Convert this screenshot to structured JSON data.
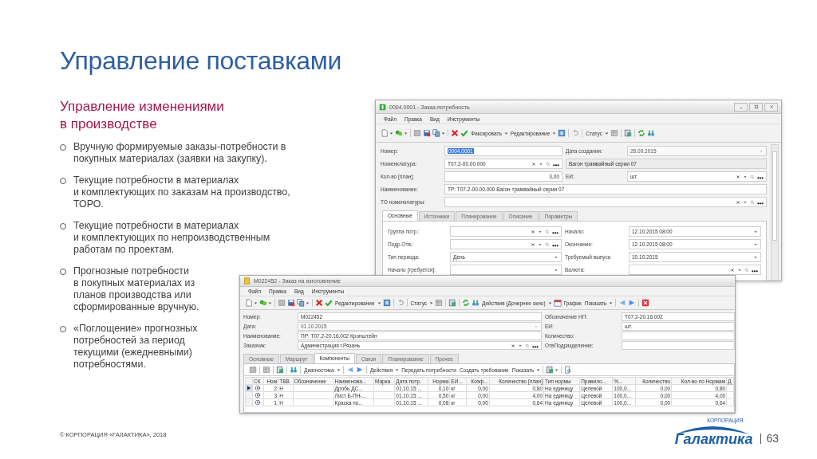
{
  "slide": {
    "title": "Управление поставками",
    "subtitle": "Управление изменениями\nв производстве",
    "bullets": [
      "Вручную формируемые заказы-потребности в\nпокупных материалах (заявки на закупку).",
      "Текущие потребности в материалах\nи комплектующих по заказам на производство,\nТОРО.",
      "Текущие потребности в материалах\nи комплектующих по непроизводственным\nработам по проектам.",
      "Прогнозные потребности\nв покупных материалах из\nпланов производства или\nсформированные вручную.",
      "«Поглощение» прогнозных\nпотребностей за период\nтекущими (ежедневными)\nпотребностями."
    ],
    "footer": "© КОРПОРАЦИЯ «ГАЛАКТИКА», 2018",
    "logo": {
      "tagline": "КОРПОРАЦИЯ",
      "name": "Галактика"
    },
    "page_number": "63"
  },
  "windows": [
    {
      "title": "0004.0001 - Заказ-потребность",
      "menu": [
        "Файл",
        "Правка",
        "Вид",
        "Инструменты"
      ],
      "toolbar": [
        {
          "kind": "new",
          "menu": true
        },
        {
          "kind": "add",
          "menu": true
        },
        {
          "kind": "separator"
        },
        {
          "kind": "store"
        },
        {
          "kind": "save"
        },
        {
          "kind": "copy",
          "menu": true
        },
        {
          "kind": "separator"
        },
        {
          "kind": "delete"
        },
        {
          "kind": "confirm"
        },
        {
          "kind": "text",
          "label": "Фиксировать",
          "menu": true
        },
        {
          "kind": "text",
          "label": "Редактирование",
          "menu": true
        },
        {
          "kind": "help"
        },
        {
          "kind": "separator"
        },
        {
          "kind": "undo"
        },
        {
          "kind": "separator"
        },
        {
          "kind": "text",
          "label": "Статус",
          "menu": true
        },
        {
          "kind": "grid"
        },
        {
          "kind": "separator"
        },
        {
          "kind": "report"
        },
        {
          "kind": "separator"
        },
        {
          "kind": "refresh"
        },
        {
          "kind": "find"
        }
      ],
      "form": [
        [
          {
            "label": "Номер:",
            "value": "0004.0001",
            "kind": "focused"
          },
          {
            "label": "Дата создания:",
            "value": "28.09.2015",
            "kind": "locked"
          }
        ],
        [
          {
            "label": "Номенклатура:",
            "value": "Т07.2-00.00.000",
            "kind": "lookup"
          },
          {
            "value": "Вагон трамвайный серии 07",
            "kind": "readonly"
          }
        ],
        [
          {
            "label": "Кол-во [план]:",
            "value": "3,00",
            "kind": "number"
          },
          {
            "label": "ЕИ:",
            "value": "шт.",
            "kind": "lookup"
          }
        ],
        [
          {
            "label": "Наименование:",
            "value": "ТР: Т07.2-00.00.000 Вагон трамвайный серии 07",
            "kind": "text",
            "wide": true
          }
        ],
        [
          {
            "label": "ТО номенклатуры:",
            "kind": "lookup",
            "wide": true
          }
        ]
      ],
      "tabs": [
        {
          "label": "Основные",
          "selected": true
        },
        {
          "label": "Источники",
          "selected": false
        },
        {
          "label": "Планирование",
          "selected": false
        },
        {
          "label": "Описание",
          "selected": false
        },
        {
          "label": "Параметры",
          "selected": false
        }
      ],
      "panel": [
        [
          {
            "label": "Группа потр.:",
            "kind": "lookup"
          },
          {
            "label": "Начало:",
            "value": "12.10.2015 08:00",
            "kind": "combo"
          }
        ],
        [
          {
            "label": "Подр.Отв.:",
            "kind": "lookup"
          },
          {
            "label": "Окончание:",
            "value": "12.10.2015 08:00",
            "kind": "combo"
          }
        ],
        [
          {
            "label": "Тип периода:",
            "value": "День",
            "kind": "combo"
          },
          {
            "label": "Требуемый выпуск:",
            "value": "10.10.2015",
            "kind": "combo"
          }
        ],
        [
          {
            "label": "Начало [требуется]:",
            "kind": "combo"
          },
          {
            "label": "Валюта:",
            "kind": "lookup"
          }
        ]
      ]
    },
    {
      "title": "М022452 - Заказ на изготовление",
      "menu": [
        "Файл",
        "Правка",
        "Вид",
        "Инструменты"
      ],
      "toolbar": [
        {
          "kind": "new",
          "menu": true
        },
        {
          "kind": "add",
          "menu": true
        },
        {
          "kind": "separator"
        },
        {
          "kind": "store"
        },
        {
          "kind": "save"
        },
        {
          "kind": "copy",
          "menu": true
        },
        {
          "kind": "separator"
        },
        {
          "kind": "delete"
        },
        {
          "kind": "confirm"
        },
        {
          "kind": "text",
          "label": "Редактирование",
          "menu": true
        },
        {
          "kind": "help"
        },
        {
          "kind": "separator"
        },
        {
          "kind": "undo"
        },
        {
          "kind": "separator"
        },
        {
          "kind": "text",
          "label": "Статус",
          "menu": true
        },
        {
          "kind": "grid"
        },
        {
          "kind": "separator"
        },
        {
          "kind": "report"
        },
        {
          "kind": "separator"
        },
        {
          "kind": "refresh"
        },
        {
          "kind": "find"
        },
        {
          "kind": "text",
          "label": "Действия (Дочернее окно)",
          "menu": true
        },
        {
          "kind": "calendar"
        },
        {
          "kind": "text",
          "label": "График"
        },
        {
          "kind": "text",
          "label": "Показать",
          "menu": true
        },
        {
          "kind": "separator"
        },
        {
          "kind": "back"
        },
        {
          "kind": "forward"
        },
        {
          "kind": "separator"
        },
        {
          "kind": "close"
        }
      ],
      "form": [
        [
          {
            "label": "Номер:",
            "value": "М022452",
            "kind": "text"
          },
          {
            "label": "Обозначение НП:",
            "value": "Т07.2-20.16.002",
            "kind": "text"
          }
        ],
        [
          {
            "label": "Дата:",
            "value": "01.10.2015",
            "kind": "locked"
          },
          {
            "label": "ЕИ:",
            "value": "шт.",
            "kind": "text"
          }
        ],
        [
          {
            "label": "Наименование:",
            "value": "ПР: Т07.2-20.16.002 Кронштейн",
            "kind": "text"
          },
          {
            "label": "Количество:",
            "kind": "text"
          }
        ],
        [
          {
            "label": "Заказчик:",
            "value": "Администрация г.Рязань",
            "kind": "lookup"
          },
          {
            "label": "ОтвПодразделение:",
            "kind": "text"
          }
        ]
      ],
      "tabs": [
        {
          "label": "Основные",
          "selected": false
        },
        {
          "label": "Маршрут",
          "selected": false
        },
        {
          "label": "Компоненты",
          "selected": true
        },
        {
          "label": "Связи",
          "selected": false
        },
        {
          "label": "Планирование",
          "selected": false
        },
        {
          "label": "Прочее",
          "selected": false
        }
      ],
      "subtoolbar": [
        {
          "kind": "store"
        },
        {
          "kind": "separator"
        },
        {
          "kind": "grid"
        },
        {
          "kind": "separator"
        },
        {
          "kind": "report"
        },
        {
          "kind": "separator"
        },
        {
          "kind": "find"
        },
        {
          "kind": "separator"
        },
        {
          "kind": "text",
          "label": "Диагностика",
          "menu": true
        },
        {
          "kind": "separator"
        },
        {
          "kind": "back"
        },
        {
          "kind": "forward"
        },
        {
          "kind": "separator"
        },
        {
          "kind": "text",
          "label": "Действия",
          "menu": true
        },
        {
          "kind": "text",
          "label": "Передать потребности"
        },
        {
          "kind": "text",
          "label": "Создать требование"
        },
        {
          "kind": "text",
          "label": "Показать",
          "menu": true
        },
        {
          "kind": "separator"
        },
        {
          "kind": "report",
          "menu": true
        },
        {
          "kind": "separator"
        },
        {
          "kind": "preview"
        }
      ],
      "table": {
        "columns": [
          {
            "label": "СК",
            "kind": "icon"
          },
          {
            "label": "Ном",
            "kind": "number"
          },
          {
            "label": "ТВВ",
            "kind": "text"
          },
          {
            "label": "Обозначение",
            "kind": "text"
          },
          {
            "label": "Наименова...",
            "kind": "text"
          },
          {
            "label": "Марка",
            "kind": "text"
          },
          {
            "label": "Дата потр.",
            "kind": "text"
          },
          {
            "label": "Норма",
            "kind": "number"
          },
          {
            "label": "ЕИ...",
            "kind": "text"
          },
          {
            "label": "Коэф...",
            "kind": "number"
          },
          {
            "label": "Количество [план]",
            "kind": "number"
          },
          {
            "label": "Тип нормы",
            "kind": "text"
          },
          {
            "label": "Правило...",
            "kind": "text"
          },
          {
            "label": "%...",
            "kind": "text"
          },
          {
            "label": "Количество",
            "kind": "number"
          },
          {
            "label": "Кол-во по Нормам",
            "kind": "number"
          },
          {
            "label": "Д",
            "kind": "text"
          }
        ],
        "rows": [
          {
            "selected": true,
            "cells": [
              "",
              "2",
              "Н",
              "",
              "Дробь ДС...",
              "",
              "01.10.15 ...",
              "0,10",
              "кг",
              "0,00",
              "0,80",
              "На единицу",
              "Целевой",
              "100,0...",
              "0,00",
              "0,80",
              ""
            ]
          },
          {
            "selected": false,
            "cells": [
              "",
              "3",
              "Н",
              "",
              "Лист Б-ПН-...",
              "",
              "01.10.15 ...",
              "0,50",
              "кг",
              "0,00",
              "4,00",
              "На единицу",
              "Целевой",
              "100,0...",
              "0,00",
              "4,00",
              ""
            ]
          },
          {
            "selected": false,
            "cells": [
              "",
              "1",
              "Н",
              "",
              "Краска по...",
              "",
              "01.10.15 ...",
              "0,08",
              "кг",
              "0,00",
              "0,64",
              "На единицу",
              "Целевой",
              "100,0...",
              "0,00",
              "0,64",
              ""
            ]
          }
        ]
      }
    }
  ]
}
